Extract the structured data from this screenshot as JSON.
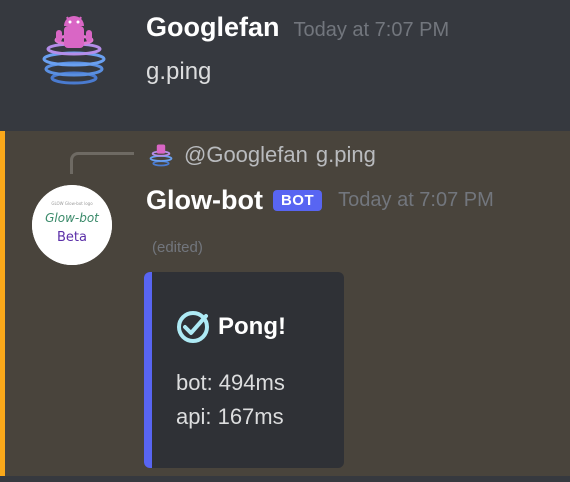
{
  "message1": {
    "username": "Googlefan",
    "timestamp": "Today at 7:07 PM",
    "content": "g.ping",
    "avatar_icon": "android-spinning-rings-icon"
  },
  "message2": {
    "reply": {
      "mention": "@Googlefan",
      "preview": "g.ping",
      "avatar_icon": "android-spinning-rings-icon"
    },
    "username": "Glow-bot",
    "bot_tag": "BOT",
    "timestamp": "Today at 7:07 PM",
    "edited": "(edited)",
    "avatar": {
      "top_text": "GLOW Glow-bot logo",
      "line1": "Glow-bot",
      "line2": "Beta"
    },
    "embed": {
      "title": "Pong!",
      "title_icon": "check-circle-icon",
      "accent_color": "#5865f2",
      "bot_latency": "bot: 494ms",
      "api_latency": "api: 167ms"
    }
  },
  "colors": {
    "background": "#36393f",
    "highlight": "#49443c",
    "highlight_bar": "#faa81a",
    "bot_tag": "#5865f2"
  }
}
